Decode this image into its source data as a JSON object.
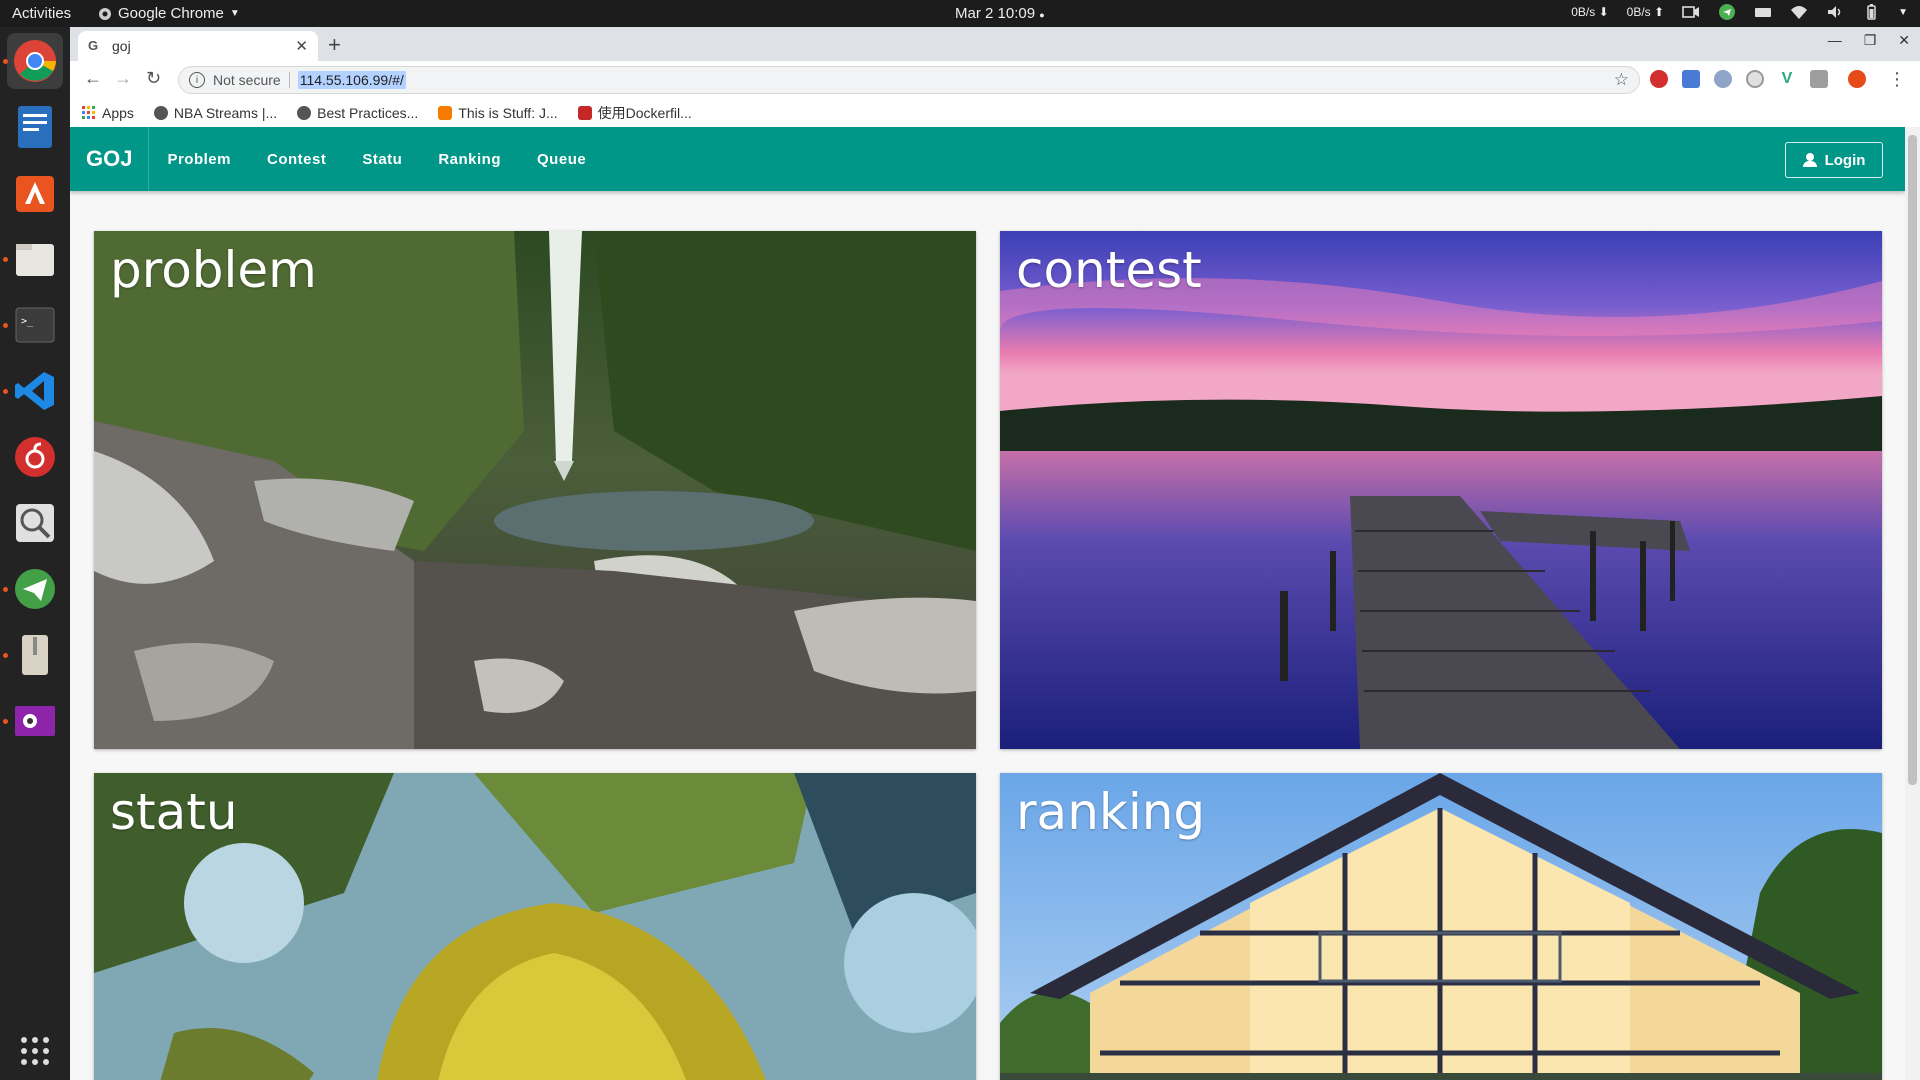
{
  "topbar": {
    "activities": "Activities",
    "app_name": "Google Chrome",
    "clock": "Mar 2  10:09",
    "net_down": "0B/s",
    "net_up": "0B/s"
  },
  "browser": {
    "tab_title": "goj",
    "security_label": "Not secure",
    "url": "114.55.106.99/#/",
    "bookmarks": [
      {
        "label": "Apps",
        "color": "#4285f4"
      },
      {
        "label": "NBA Streams |...",
        "color": "#333333"
      },
      {
        "label": "Best Practices...",
        "color": "#333333"
      },
      {
        "label": "This is Stuff: J...",
        "color": "#f57c00"
      },
      {
        "label": "使用Dockerfil...",
        "color": "#c62828"
      }
    ]
  },
  "app": {
    "brand": "GOJ",
    "nav": [
      "Problem",
      "Contest",
      "Statu",
      "Ranking",
      "Queue"
    ],
    "login_label": "Login",
    "accent": "#009688",
    "cards": [
      {
        "title": "problem"
      },
      {
        "title": "contest"
      },
      {
        "title": "statu"
      },
      {
        "title": "ranking"
      }
    ]
  }
}
